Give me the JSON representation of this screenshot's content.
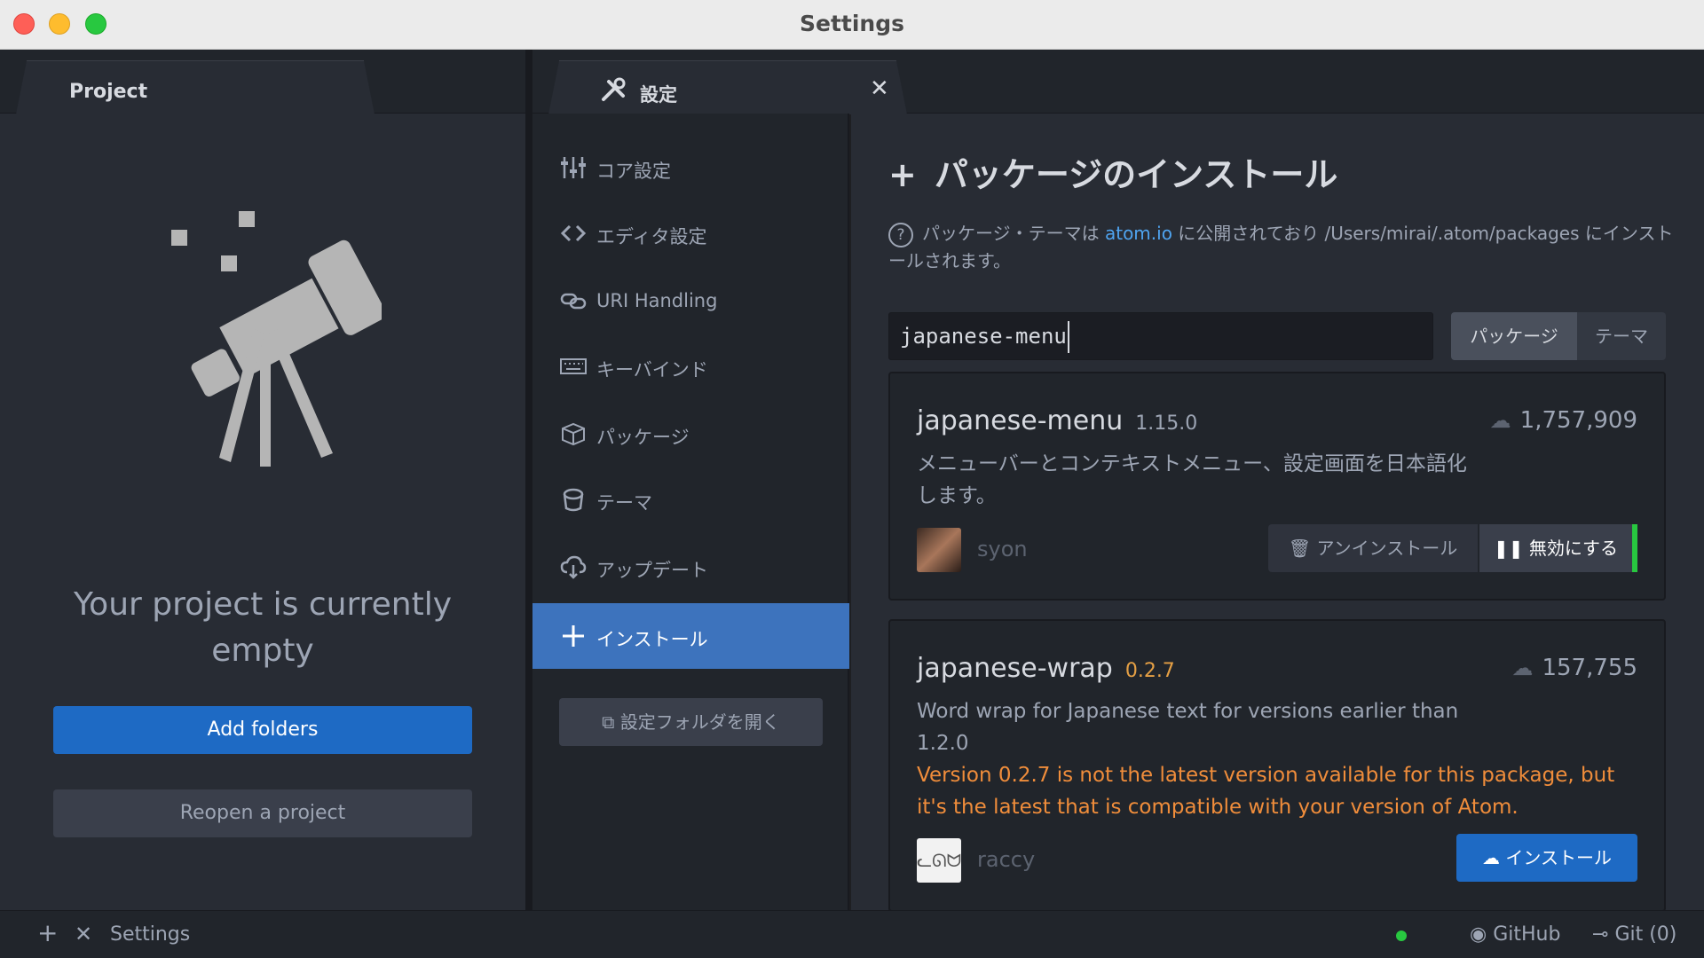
{
  "window": {
    "title": "Settings"
  },
  "project": {
    "tab_label": "Project",
    "empty_message": "Your project is currently empty",
    "add_folders": "Add folders",
    "reopen_project": "Reopen a project"
  },
  "settings_tab": {
    "label": "設定",
    "icon": "tools-icon",
    "close": "✕"
  },
  "nav": {
    "items": [
      {
        "label": "コア設定",
        "icon": "sliders-icon"
      },
      {
        "label": "エディタ設定",
        "icon": "code-icon"
      },
      {
        "label": "URI Handling",
        "icon": "link-icon"
      },
      {
        "label": "キーバインド",
        "icon": "keyboard-icon"
      },
      {
        "label": "パッケージ",
        "icon": "package-icon"
      },
      {
        "label": "テーマ",
        "icon": "paintcan-icon"
      },
      {
        "label": "アップデート",
        "icon": "cloud-download-icon"
      },
      {
        "label": "インストール",
        "icon": "plus-icon",
        "active": true
      }
    ],
    "open_folder": "設定フォルダを開く"
  },
  "install": {
    "title": "パッケージのインストール",
    "info_prefix": "パッケージ・テーマは",
    "info_link": "atom.io",
    "info_suffix": "に公開されており /Users/mirai/.atom/packages にインストールされます。",
    "search_value": "japanese-menu",
    "toggle_packages": "パッケージ",
    "toggle_themes": "テーマ"
  },
  "packages": [
    {
      "name": "japanese-menu",
      "version": "1.15.0",
      "downloads": "1,757,909",
      "description": "メニューバーとコンテキストメニュー、設定画面を日本語化します。",
      "author": "syon",
      "uninstall": "アンインストール",
      "disable": "無効にする"
    },
    {
      "name": "japanese-wrap",
      "version": "0.2.7",
      "downloads": "157,755",
      "description": "Word wrap for Japanese text for versions earlier than 1.2.0",
      "warning": "Version 0.2.7 is not the latest version available for this package, but it's the latest that is compatible with your version of Atom.",
      "author": "raccy",
      "install": "インストール"
    }
  ],
  "statusbar": {
    "label": "Settings",
    "github": "GitHub",
    "git": "Git (0)"
  }
}
